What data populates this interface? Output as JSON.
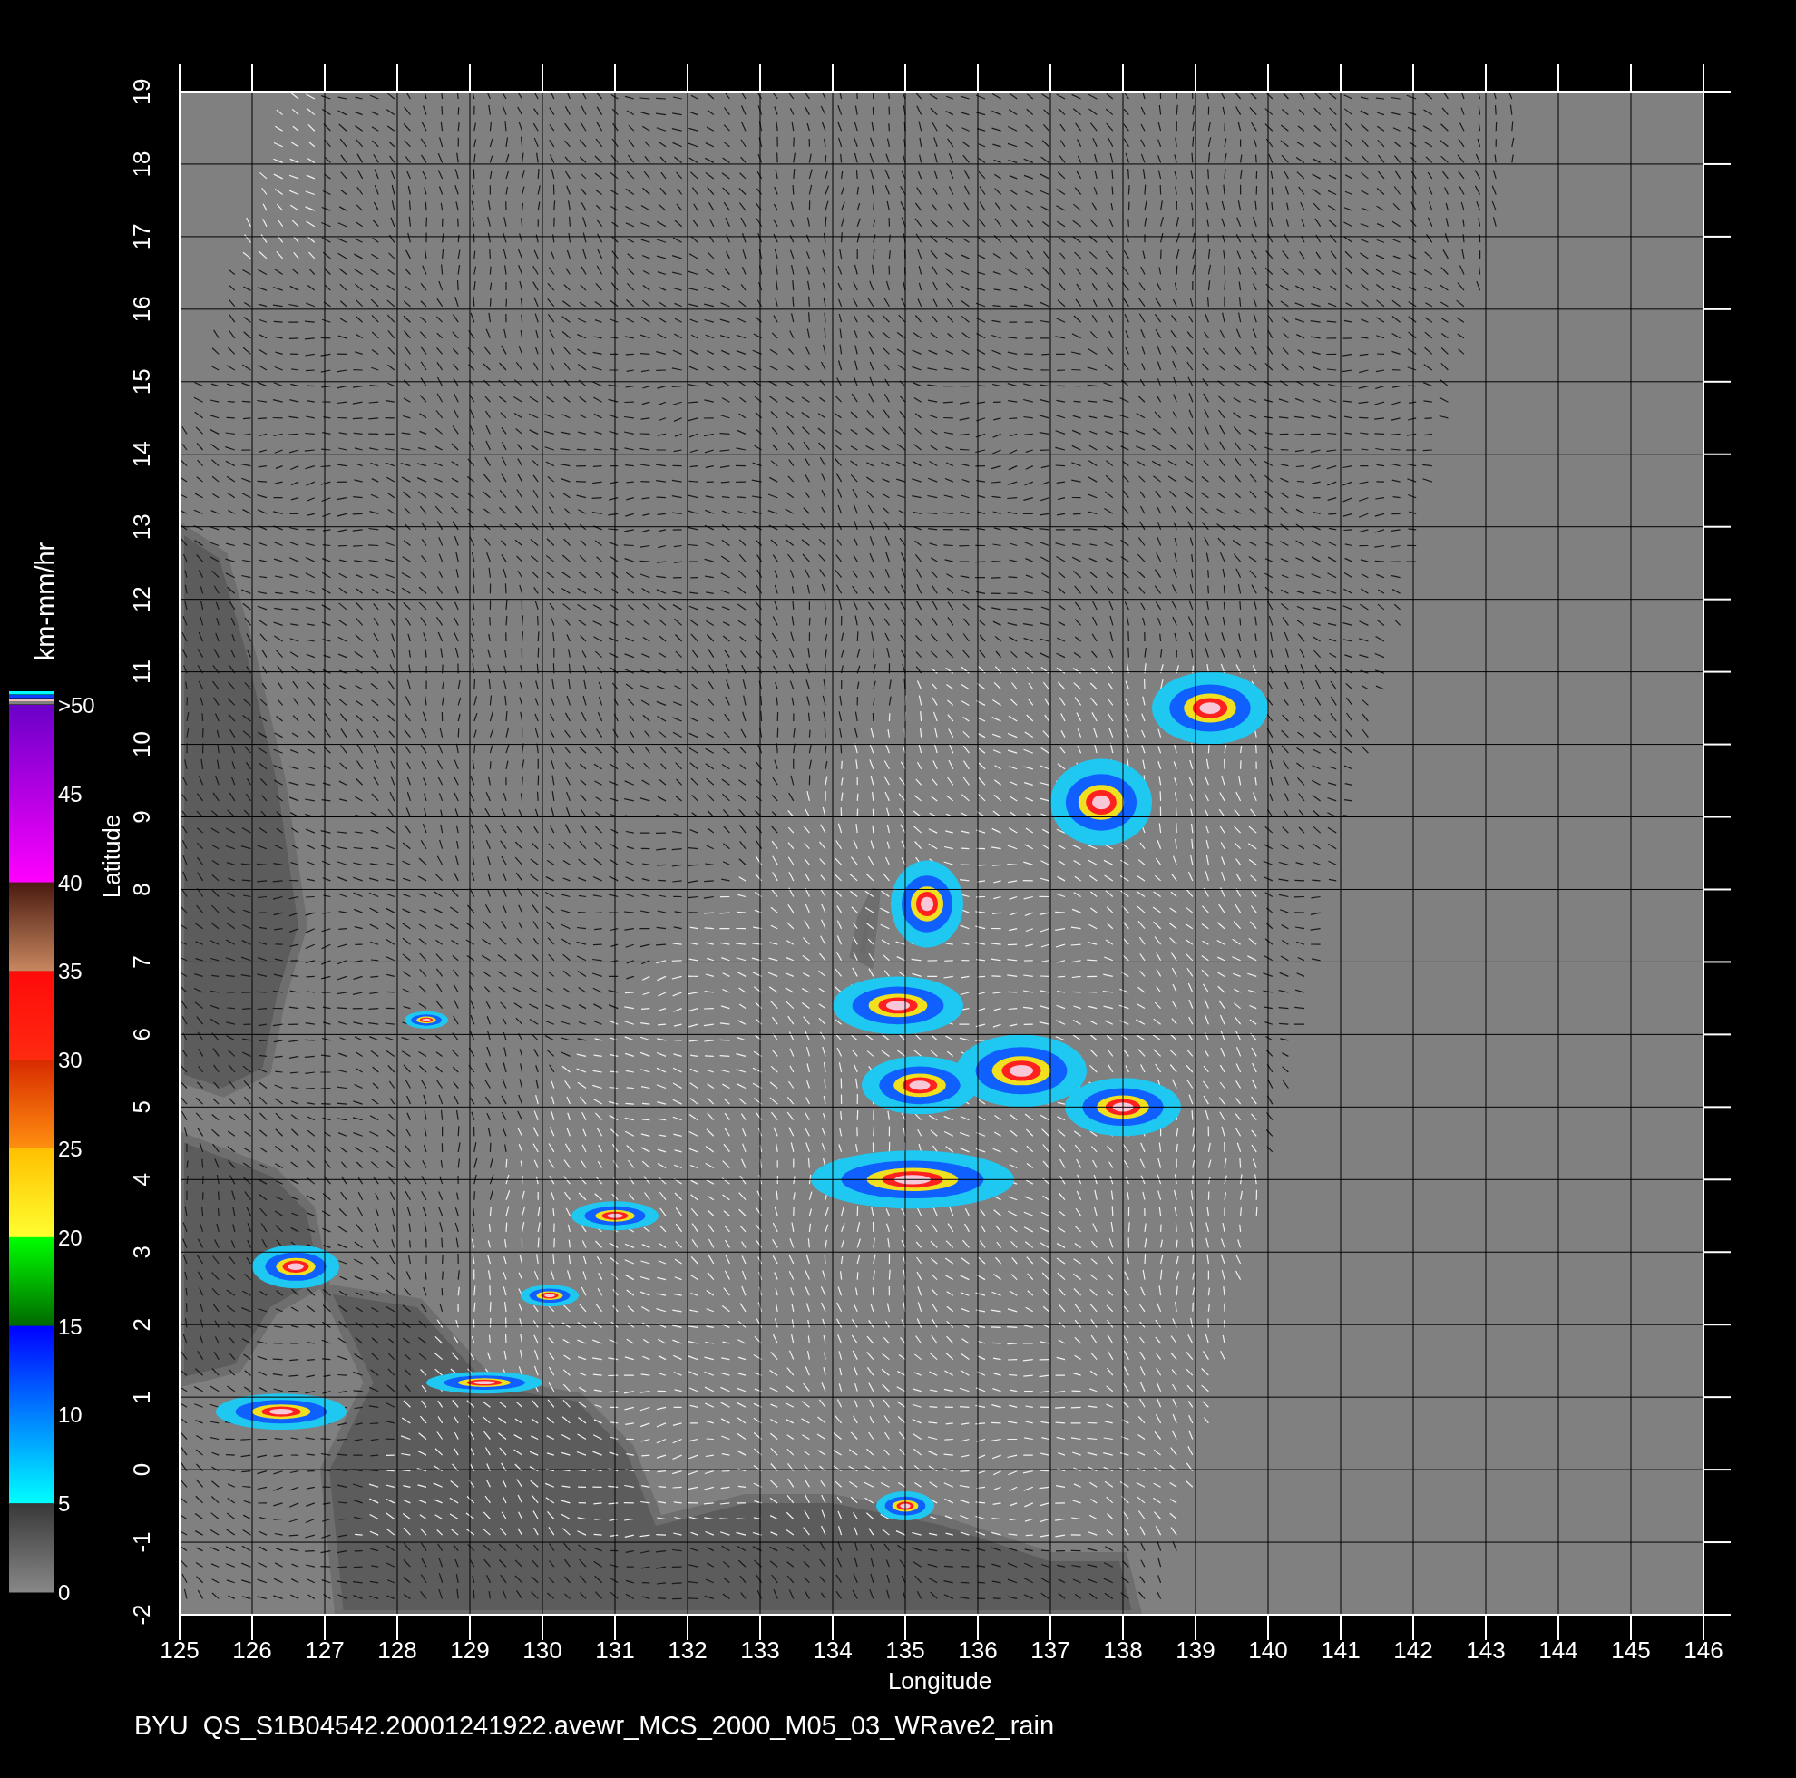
{
  "colorbar": {
    "title": "km-mm/hr",
    "labels": [
      ">50",
      "45",
      "40",
      "35",
      "30",
      "25",
      "20",
      "15",
      "10",
      "5",
      "0"
    ]
  },
  "map": {
    "xlabel": "Longitude",
    "ylabel": "Latitude",
    "xticks": [
      "125",
      "126",
      "127",
      "128",
      "129",
      "130",
      "131",
      "132",
      "133",
      "134",
      "135",
      "136",
      "137",
      "138",
      "139",
      "140",
      "141",
      "142",
      "143",
      "144",
      "145",
      "146"
    ],
    "yticks": [
      "19",
      "18",
      "17",
      "16",
      "15",
      "14",
      "13",
      "12",
      "11",
      "10",
      "9",
      "8",
      "7",
      "6",
      "5",
      "4",
      "3",
      "2",
      "1",
      "0",
      "-1",
      "-2"
    ]
  },
  "caption": "BYU  QS_S1B04542.20001241922.avewr_MCS_2000_M05_03_WRave2_rain"
}
